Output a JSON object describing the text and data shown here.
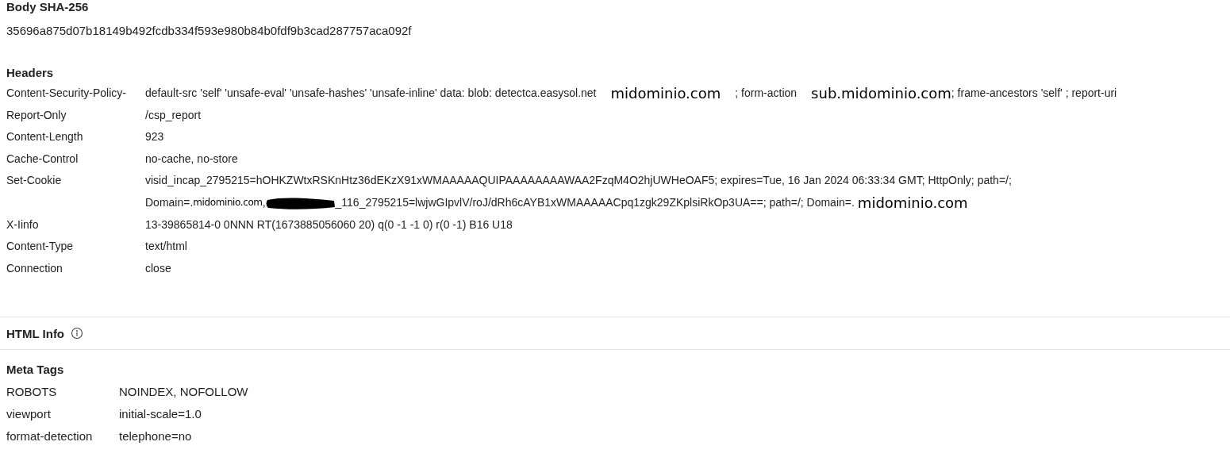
{
  "body_sha256": {
    "title": "Body SHA-256",
    "value": "35696a875d07b18149b492fcdb334f593e980b84b0fdf9b3cad287757aca092f"
  },
  "headers": {
    "title": "Headers",
    "rows": [
      {
        "key": "Content-Security-Policy-Report-Only",
        "lines": [
          [
            {
              "kind": "text",
              "text": "default-src 'self' 'unsafe-eval' 'unsafe-hashes' 'unsafe-inline' data: blob: detectca.easysol.net"
            },
            {
              "kind": "pasted-large",
              "text": "midominio.com"
            },
            {
              "kind": "text",
              "text": "; form-action"
            },
            {
              "kind": "pasted-large",
              "text": "sub.midominio.com"
            },
            {
              "kind": "text",
              "text": "; frame-ancestors 'self' ; report-uri"
            }
          ],
          [
            {
              "kind": "text",
              "text": "/csp_report"
            }
          ]
        ]
      },
      {
        "key": "Content-Length",
        "lines": [
          [
            {
              "kind": "text",
              "text": "923"
            }
          ]
        ]
      },
      {
        "key": "Cache-Control",
        "lines": [
          [
            {
              "kind": "text",
              "text": "no-cache, no-store"
            }
          ]
        ]
      },
      {
        "key": "Set-Cookie",
        "lines": [
          [
            {
              "kind": "text",
              "text": "visid_incap_2795215=hOHKZWtxRSKnHtz36dEKzX91xWMAAAAAQUIPAAAAAAAAWAA2FzqM4O2hjUWHeOAF5; expires=Tue, 16 Jan 2024 06:33:34 GMT; HttpOnly; path=/;"
            }
          ],
          [
            {
              "kind": "text",
              "text": "Domain=."
            },
            {
              "kind": "pasted-small",
              "text": "midominio.com"
            },
            {
              "kind": "text",
              "text": ","
            },
            {
              "kind": "redaction"
            },
            {
              "kind": "text",
              "text": "_116_2795215=lwjwGIpvlV/roJ/dRh6cAYB1xWMAAAAACpq1zgk29ZKplsiRkOp3UA==; path=/; Domain=."
            },
            {
              "kind": "pasted-large",
              "text": "midominio.com"
            }
          ]
        ]
      },
      {
        "key": "X-Iinfo",
        "lines": [
          [
            {
              "kind": "text",
              "text": "13-39865814-0 0NNN RT(1673885056060 20) q(0 -1 -1 0) r(0 -1) B16 U18"
            }
          ]
        ]
      },
      {
        "key": "Content-Type",
        "lines": [
          [
            {
              "kind": "text",
              "text": "text/html"
            }
          ]
        ]
      },
      {
        "key": "Connection",
        "lines": [
          [
            {
              "kind": "text",
              "text": "close"
            }
          ]
        ]
      }
    ]
  },
  "html_info": {
    "title": "HTML Info"
  },
  "meta_tags": {
    "title": "Meta Tags",
    "rows": [
      {
        "key": "ROBOTS",
        "value": "NOINDEX, NOFOLLOW"
      },
      {
        "key": "viewport",
        "value": "initial-scale=1.0"
      },
      {
        "key": "format-detection",
        "value": "telephone=no"
      }
    ]
  }
}
